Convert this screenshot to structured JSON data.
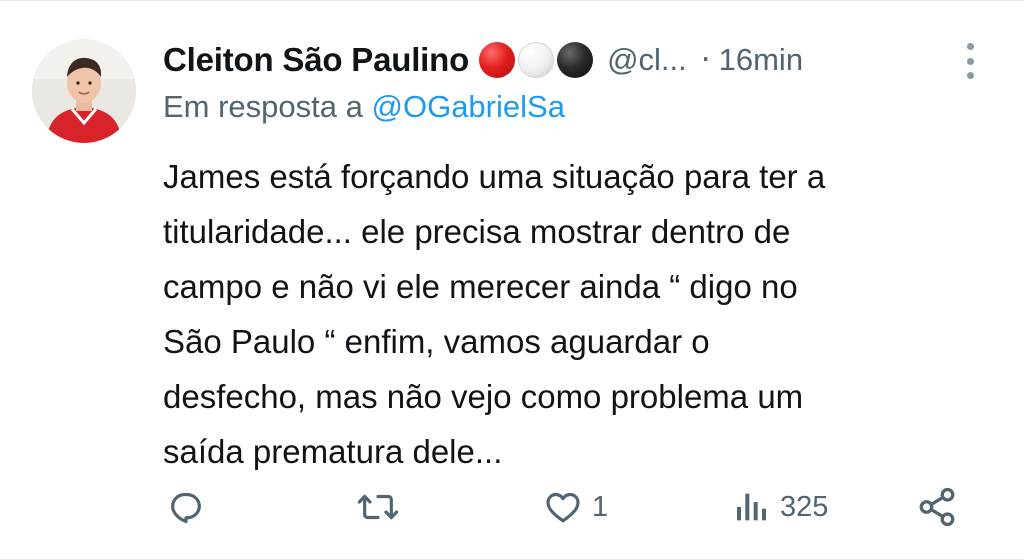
{
  "tweet": {
    "display_name": "Cleiton São Paulino",
    "handle": "@cl...",
    "separator": "·",
    "time": "16min",
    "reply_prefix": "Em resposta a",
    "reply_to": "@OGabrielSa",
    "text": "James está forçando uma situação para ter a\ntitularidade... ele precisa mostrar dentro de\ncampo e não vi ele merecer ainda “ digo no\nSão Paulo “ enfim, vamos aguardar o\ndesfecho, mas não vejo como problema um\nsaída prematura dele...",
    "flag_emoji": [
      "red-circle",
      "white-circle",
      "black-circle"
    ]
  },
  "actions": {
    "reply": {
      "icon": "reply-icon",
      "count": ""
    },
    "retweet": {
      "icon": "retweet-icon",
      "count": ""
    },
    "like": {
      "icon": "heart-icon",
      "count": "1"
    },
    "views": {
      "icon": "views-icon",
      "count": "325"
    },
    "share": {
      "icon": "share-icon"
    }
  },
  "colors": {
    "text": "#0f1419",
    "secondary": "#536471",
    "link": "#1d9bf0"
  }
}
